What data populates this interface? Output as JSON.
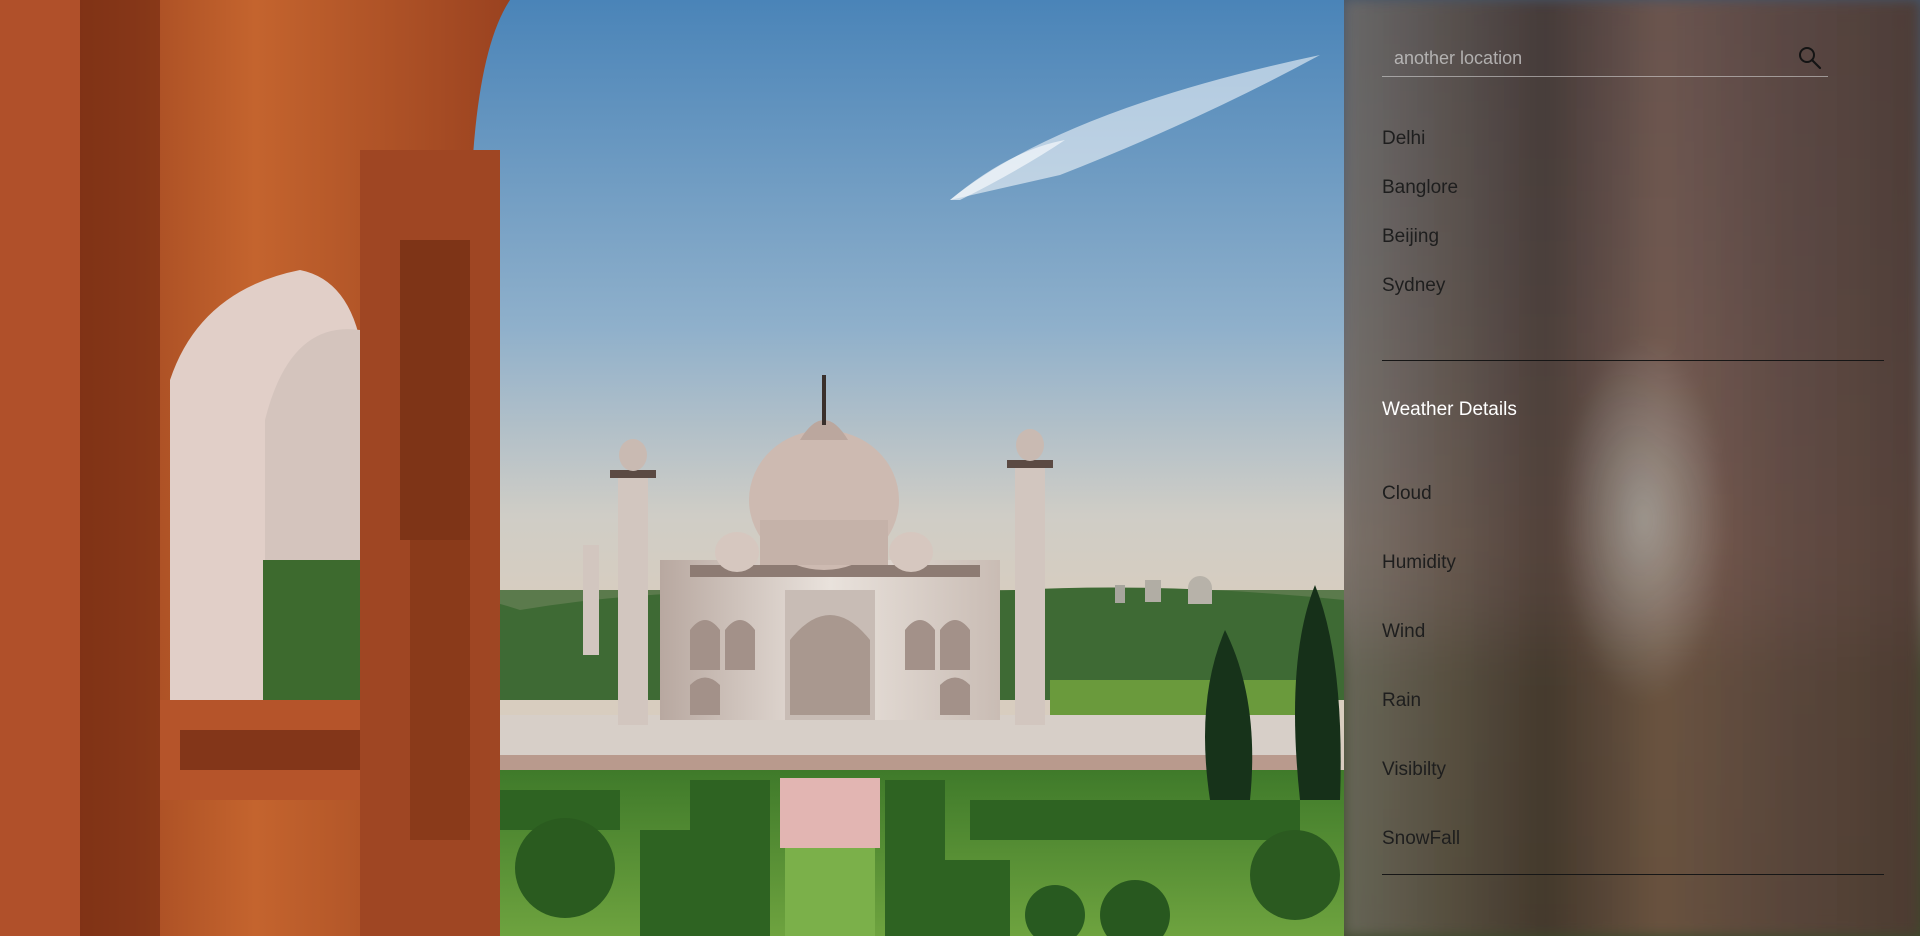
{
  "search": {
    "placeholder": "another location",
    "icon": "search-icon"
  },
  "cities": [
    "Delhi",
    "Banglore",
    "Beijing",
    "Sydney"
  ],
  "details": {
    "title": "Weather Details",
    "items": [
      "Cloud",
      "Humidity",
      "Wind",
      "Rain",
      "Visibilty",
      "SnowFall"
    ]
  }
}
